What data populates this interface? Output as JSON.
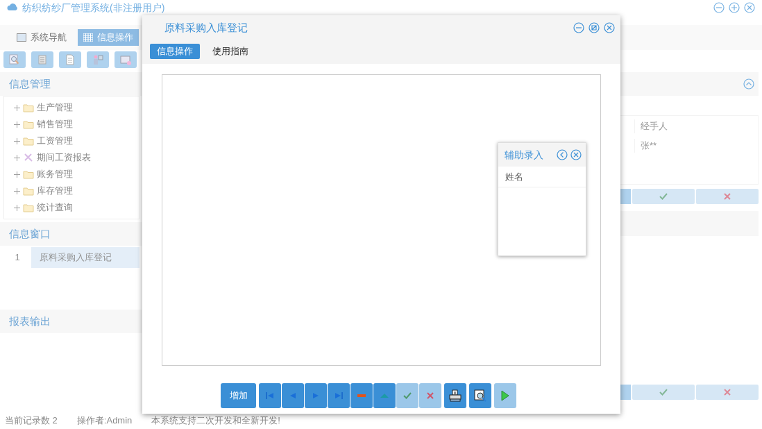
{
  "app": {
    "title": "纺织纺纱厂管理系统(非注册用户)",
    "nav_tabs": [
      {
        "label": "系统导航",
        "selected": false
      },
      {
        "label": "信息操作",
        "selected": true
      }
    ],
    "tool_icons": [
      {
        "kind": "search"
      },
      {
        "kind": "list"
      },
      {
        "kind": "document"
      },
      {
        "kind": "people"
      },
      {
        "kind": "screen"
      }
    ],
    "panels": {
      "info_manage": {
        "title": "信息管理",
        "tree": [
          {
            "label": "生产管理",
            "kind": "folder",
            "expanded": false
          },
          {
            "label": "销售管理",
            "kind": "folder",
            "expanded": false
          },
          {
            "label": "工资管理",
            "kind": "folder",
            "expanded": false
          },
          {
            "label": "期间工资报表",
            "kind": "tool",
            "expanded": false
          },
          {
            "label": "账务管理",
            "kind": "folder",
            "expanded": false
          },
          {
            "label": "库存管理",
            "kind": "folder",
            "expanded": false
          },
          {
            "label": "统计查询",
            "kind": "folder",
            "expanded": false
          }
        ]
      },
      "info_window": {
        "title": "信息窗口",
        "rows": [
          {
            "index": "1",
            "name": "原料采购入库登记",
            "selected": true
          }
        ]
      },
      "report": {
        "title": "报表输出"
      }
    },
    "right_table": {
      "columns": [
        "经手人"
      ],
      "rows": [
        [
          "张**"
        ]
      ]
    },
    "status_bar": [
      "当前记录数 2",
      "操作者:Admin",
      "本系统支持二次开发和全新开发!"
    ]
  },
  "dialog": {
    "title": "原料采购入库登记",
    "tabs": [
      {
        "label": "信息操作",
        "selected": true
      },
      {
        "label": "使用指南",
        "selected": false
      }
    ],
    "helper": {
      "title": "辅助录入",
      "column": "姓名"
    },
    "toolbar": [
      {
        "kind": "text",
        "label": "增加",
        "disabled": false
      },
      {
        "kind": "first",
        "disabled": false
      },
      {
        "kind": "prev",
        "disabled": false
      },
      {
        "kind": "next",
        "disabled": false
      },
      {
        "kind": "last",
        "disabled": false
      },
      {
        "kind": "minus",
        "disabled": false
      },
      {
        "kind": "up",
        "disabled": false
      },
      {
        "kind": "check",
        "disabled": true
      },
      {
        "kind": "cancel",
        "disabled": true
      },
      {
        "kind": "print",
        "disabled": false
      },
      {
        "kind": "preview",
        "disabled": false
      },
      {
        "kind": "run",
        "disabled": true
      }
    ]
  }
}
